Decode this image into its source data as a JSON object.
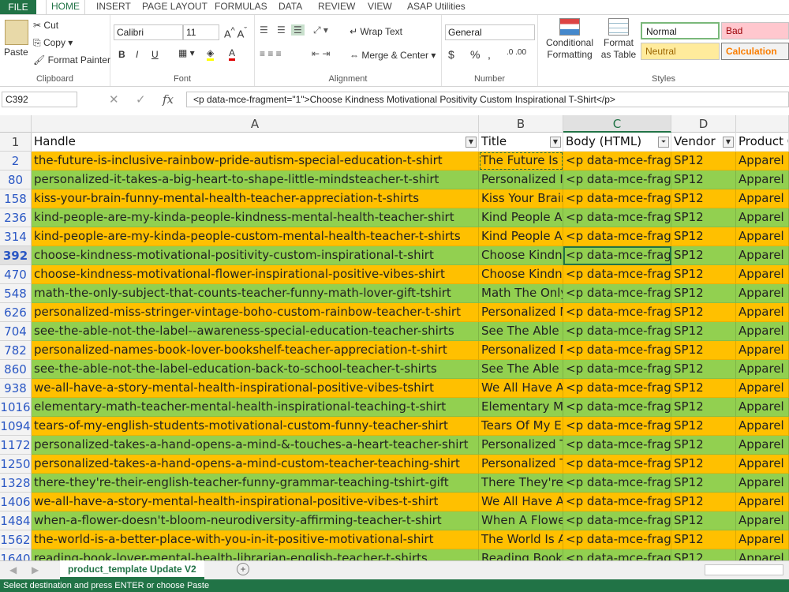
{
  "menu": {
    "file": "FILE",
    "tabs": [
      "HOME",
      "INSERT",
      "PAGE LAYOUT",
      "FORMULAS",
      "DATA",
      "REVIEW",
      "VIEW",
      "ASAP Utilities"
    ]
  },
  "ribbon": {
    "clipboard": {
      "paste": "Paste",
      "cut": "Cut",
      "copy": "Copy",
      "format_painter": "Format Painter",
      "label": "Clipboard"
    },
    "font": {
      "name": "Calibri",
      "size": "11",
      "bold": "B",
      "italic": "I",
      "underline": "U",
      "label": "Font"
    },
    "alignment": {
      "wrap": "Wrap Text",
      "merge": "Merge & Center",
      "label": "Alignment"
    },
    "number": {
      "format": "General",
      "currency": "$",
      "percent": "%",
      "comma": ",",
      "label": "Number"
    },
    "styles": {
      "conditional": "Conditional Formatting",
      "format_table": "Format as Table",
      "normal": "Normal",
      "bad": "Bad",
      "neutral": "Neutral",
      "calculation": "Calculation",
      "label": "Styles"
    }
  },
  "formula_bar": {
    "name_box": "C392",
    "fx": "fx",
    "content": "<p data-mce-fragment=\"1\">Choose Kindness Motivational Positivity Custom Inspirational T-Shirt</p>"
  },
  "columns": [
    "A",
    "B",
    "C",
    "D",
    ""
  ],
  "header_row": {
    "num": "1",
    "cells": [
      "Handle",
      "Title",
      "Body (HTML)",
      "Vendor",
      "Product C"
    ]
  },
  "colors": {
    "orange": "#ffc000",
    "green": "#92d050",
    "excel_green": "#217346"
  },
  "rows": [
    {
      "num": "2",
      "handle": "the-future-is-inclusive-rainbow-pride-autism-special-education-t-shirt",
      "title": "The Future Is Inclusive",
      "body": "<p data-mce-fragment",
      "vendor": "SP12",
      "type": "Apparel",
      "color": "orange"
    },
    {
      "num": "80",
      "handle": "personalized-it-takes-a-big-heart-to-shape-little-mindsteacher-t-shirt",
      "title": "Personalized It",
      "body": "<p data-mce-fragment",
      "vendor": "SP12",
      "type": "Apparel",
      "color": "green"
    },
    {
      "num": "158",
      "handle": "kiss-your-brain-funny-mental-health-teacher-appreciation-t-shirts",
      "title": "Kiss Your Brain",
      "body": "<p data-mce-fragment",
      "vendor": "SP12",
      "type": "Apparel",
      "color": "orange"
    },
    {
      "num": "236",
      "handle": "kind-people-are-my-kinda-people-kindness-mental-health-teacher-shirt",
      "title": "Kind People Are",
      "body": "<p data-mce-fragment",
      "vendor": "SP12",
      "type": "Apparel",
      "color": "green"
    },
    {
      "num": "314",
      "handle": "kind-people-are-my-kinda-people-custom-mental-health-teacher-t-shirts",
      "title": "Kind People Are",
      "body": "<p data-mce-fragment",
      "vendor": "SP12",
      "type": "Apparel",
      "color": "orange"
    },
    {
      "num": "392",
      "handle": "choose-kindness-motivational-positivity-custom-inspirational-t-shirt",
      "title": "Choose Kindness",
      "body": "<p data-mce-fragment",
      "vendor": "SP12",
      "type": "Apparel",
      "color": "green",
      "active": true
    },
    {
      "num": "470",
      "handle": "choose-kindness-motivational-flower-inspirational-positive-vibes-shirt",
      "title": "Choose Kindness",
      "body": "<p data-mce-fragment",
      "vendor": "SP12",
      "type": "Apparel",
      "color": "orange"
    },
    {
      "num": "548",
      "handle": "math-the-only-subject-that-counts-teacher-funny-math-lover-gift-tshirt",
      "title": "Math The Only",
      "body": "<p data-mce-fragment",
      "vendor": "SP12",
      "type": "Apparel",
      "color": "green"
    },
    {
      "num": "626",
      "handle": "personalized-miss-stringer-vintage-boho-custom-rainbow-teacher-t-shirt",
      "title": "Personalized Miss",
      "body": "<p data-mce-fragment",
      "vendor": "SP12",
      "type": "Apparel",
      "color": "orange"
    },
    {
      "num": "704",
      "handle": "see-the-able-not-the-label--awareness-special-education-teacher-shirts",
      "title": "See The Able Not",
      "body": "<p data-mce-fragment",
      "vendor": "SP12",
      "type": "Apparel",
      "color": "green"
    },
    {
      "num": "782",
      "handle": "personalized-names-book-lover-bookshelf-teacher-appreciation-t-shirt",
      "title": "Personalized Names",
      "body": "<p data-mce-fragment",
      "vendor": "SP12",
      "type": "Apparel",
      "color": "orange"
    },
    {
      "num": "860",
      "handle": "see-the-able-not-the-label-education-back-to-school-teacher-t-shirts",
      "title": "See The Able Not",
      "body": "<p data-mce-fragment",
      "vendor": "SP12",
      "type": "Apparel",
      "color": "green"
    },
    {
      "num": "938",
      "handle": "we-all-have-a-story-mental-health-inspirational-positive-vibes-tshirt",
      "title": "We All Have A",
      "body": "<p data-mce-fragment",
      "vendor": "SP12",
      "type": "Apparel",
      "color": "orange"
    },
    {
      "num": "1016",
      "handle": "elementary-math-teacher-mental-health-inspirational-teaching-t-shirt",
      "title": "Elementary Math",
      "body": "<p data-mce-fragment",
      "vendor": "SP12",
      "type": "Apparel",
      "color": "green"
    },
    {
      "num": "1094",
      "handle": "tears-of-my-english-students-motivational-custom-funny-teacher-shirt",
      "title": "Tears Of My English",
      "body": "<p data-mce-fragment",
      "vendor": "SP12",
      "type": "Apparel",
      "color": "orange"
    },
    {
      "num": "1172",
      "handle": "personalized-takes-a-hand-opens-a-mind-&-touches-a-heart-teacher-shirt",
      "title": "Personalized Takes",
      "body": "<p data-mce-fragment",
      "vendor": "SP12",
      "type": "Apparel",
      "color": "green"
    },
    {
      "num": "1250",
      "handle": "personalized-takes-a-hand-opens-a-mind-custom-teacher-teaching-shirt",
      "title": "Personalized Takes",
      "body": "<p data-mce-fragment",
      "vendor": "SP12",
      "type": "Apparel",
      "color": "orange"
    },
    {
      "num": "1328",
      "handle": "there-they're-their-english-teacher-funny-grammar-teaching-tshirt-gift",
      "title": "There They're Their",
      "body": "<p data-mce-fragment",
      "vendor": "SP12",
      "type": "Apparel",
      "color": "green"
    },
    {
      "num": "1406",
      "handle": "we-all-have-a-story-mental-health-inspirational-positive-vibes-t-shirt",
      "title": "We All Have A",
      "body": "<p data-mce-fragment",
      "vendor": "SP12",
      "type": "Apparel",
      "color": "orange"
    },
    {
      "num": "1484",
      "handle": "when-a-flower-doesn't-bloom-neurodiversity-affirming-teacher-t-shirt",
      "title": "When A Flower",
      "body": "<p data-mce-fragment",
      "vendor": "SP12",
      "type": "Apparel",
      "color": "green"
    },
    {
      "num": "1562",
      "handle": "the-world-is-a-better-place-with-you-in-it-positive-motivational-shirt",
      "title": "The World Is A",
      "body": "<p data-mce-fragment",
      "vendor": "SP12",
      "type": "Apparel",
      "color": "orange"
    },
    {
      "num": "1640",
      "handle": "reading-book-lover-mental-health-librarian-english-teacher-t-shirts",
      "title": "Reading Book",
      "body": "<p data-mce-fragment",
      "vendor": "SP12",
      "type": "Apparel",
      "color": "green"
    }
  ],
  "sheet_tab": "product_template Update V2",
  "status": "Select destination and press ENTER or choose Paste"
}
